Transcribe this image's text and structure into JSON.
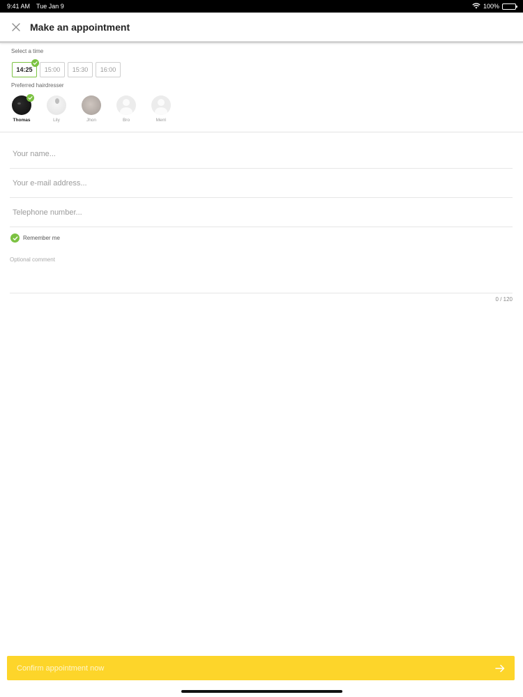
{
  "status_bar": {
    "time": "9:41 AM",
    "date": "Tue Jan 9",
    "battery": "100%"
  },
  "header": {
    "title": "Make an appointment",
    "close_icon": "close-icon"
  },
  "time_section": {
    "label": "Select a time",
    "times": [
      "14:25",
      "15:00",
      "15:30",
      "16:00"
    ],
    "selected": "14:25"
  },
  "hairdresser_section": {
    "label": "Preferred hairdresser",
    "hairdressers": [
      {
        "name": "Thomas",
        "selected": true
      },
      {
        "name": "Lily",
        "selected": false
      },
      {
        "name": "Jhon",
        "selected": false
      },
      {
        "name": "Bro",
        "selected": false
      },
      {
        "name": "Merri",
        "selected": false
      }
    ]
  },
  "form": {
    "name_placeholder": "Your name...",
    "email_placeholder": "Your e-mail address...",
    "phone_placeholder": "Telephone number...",
    "remember_label": "Remember me",
    "remember_checked": true,
    "comment_placeholder": "Optional comment",
    "counter": "0 / 120"
  },
  "confirm": {
    "label": "Confirm appointment now",
    "icon": "arrow-right-icon"
  },
  "colors": {
    "accent_yellow": "#fdd52a",
    "check_green": "#7cc242"
  }
}
